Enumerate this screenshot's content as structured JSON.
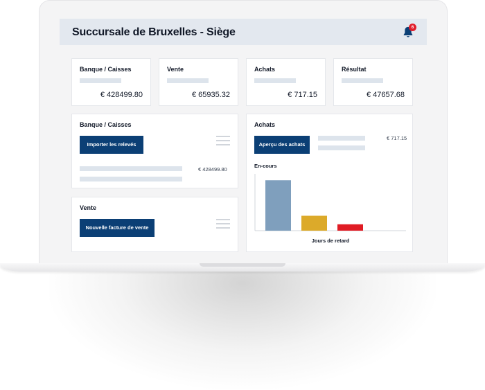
{
  "header": {
    "title": "Succursale de Bruxelles - Siège",
    "notification_count": "6"
  },
  "kpis": [
    {
      "label": "Banque / Caisses",
      "value": "€ 428499.80"
    },
    {
      "label": "Vente",
      "value": "€ 65935.32"
    },
    {
      "label": "Achats",
      "value": "€ 717.15"
    },
    {
      "label": "Résultat",
      "value": "€ 47657.68"
    }
  ],
  "bank_panel": {
    "title": "Banque / Caisses",
    "button": "Importer les relevés",
    "value": "€ 428499.80"
  },
  "sales_panel": {
    "title": "Vente",
    "button": "Nouvelle facture de vente"
  },
  "purchases_panel": {
    "title": "Achats",
    "button": "Aperçu des achats",
    "value": "€ 717.15",
    "subtitle": "En-cours"
  },
  "colors": {
    "brand": "#0b3f75",
    "bar_1": "#7f9fbd",
    "bar_2": "#dcaa2a",
    "bar_3": "#e01c24"
  },
  "chart_data": {
    "type": "bar",
    "title": "En-cours",
    "xlabel": "Jours de retard",
    "ylabel": "",
    "categories": [
      "",
      "",
      ""
    ],
    "values": [
      71,
      21,
      9
    ],
    "ylim": [
      0,
      80
    ],
    "colors": [
      "#7f9fbd",
      "#dcaa2a",
      "#e01c24"
    ],
    "grid": false,
    "legend": "none"
  }
}
